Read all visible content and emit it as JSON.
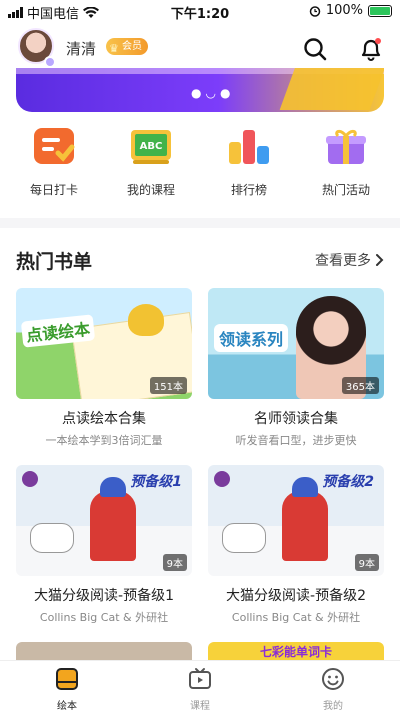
{
  "status_bar": {
    "carrier": "中国电信",
    "time": "下午1:20",
    "battery": "100%"
  },
  "header": {
    "username": "清清",
    "vip_label": "会员"
  },
  "categories": [
    {
      "label": "每日打卡",
      "icon": "checkin-icon"
    },
    {
      "label": "我的课程",
      "icon": "abc-board-icon"
    },
    {
      "label": "排行榜",
      "icon": "ranking-icon"
    },
    {
      "label": "热门活动",
      "icon": "gift-icon"
    }
  ],
  "hot_books": {
    "title": "热门书单",
    "more": "查看更多",
    "items": [
      {
        "cover_text": "点读绘本",
        "count": "151本",
        "title": "点读绘本合集",
        "subtitle": "一本绘本学到3倍词汇量"
      },
      {
        "cover_text": "领读系列",
        "count": "365本",
        "title": "名师领读合集",
        "subtitle": "听发音看口型，进步更快"
      },
      {
        "cover_text": "预备级1",
        "count": "9本",
        "title": "大猫分级阅读-预备级1",
        "subtitle": "Collins Big Cat & 外研社"
      },
      {
        "cover_text": "预备级2",
        "count": "9本",
        "title": "大猫分级阅读-预备级2",
        "subtitle": "Collins Big Cat & 外研社"
      }
    ],
    "partial_card_text": "七彩能单词卡"
  },
  "tabbar": [
    {
      "label": "绘本",
      "active": true
    },
    {
      "label": "课程",
      "active": false
    },
    {
      "label": "我的",
      "active": false
    }
  ],
  "colors": {
    "accent": "#f2a51e",
    "banner": "#6b35ef"
  }
}
